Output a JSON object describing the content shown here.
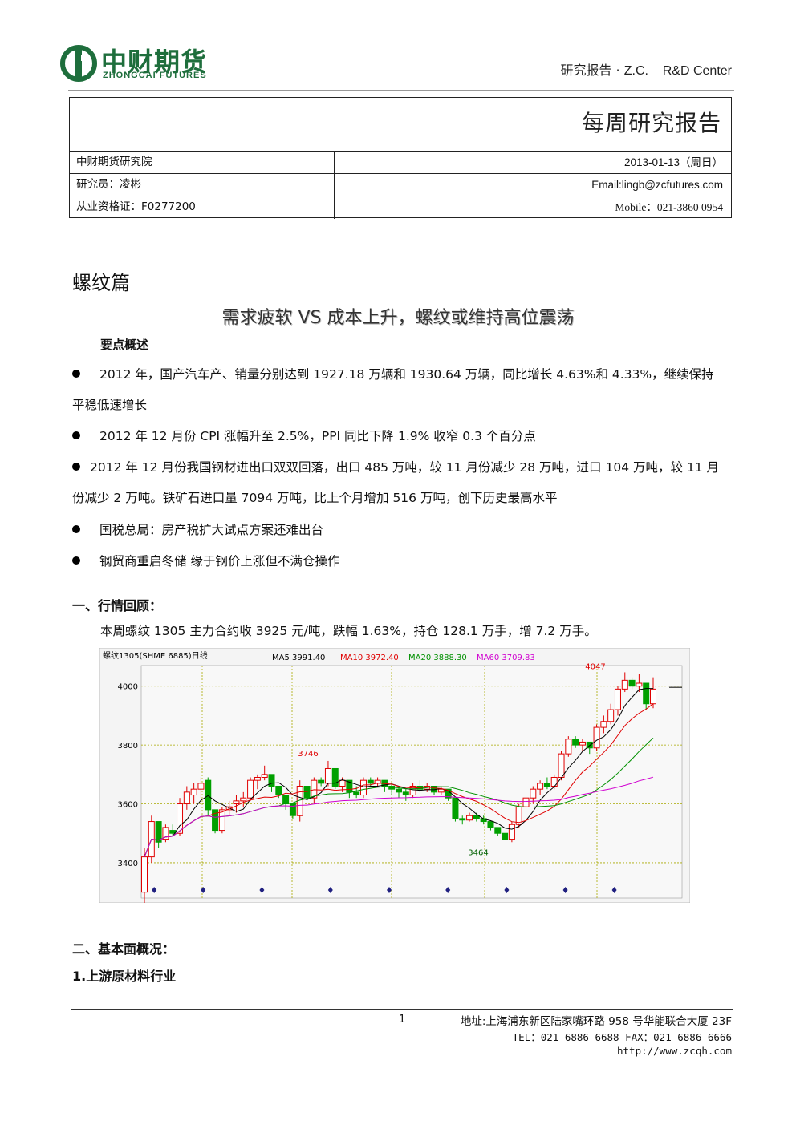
{
  "header": {
    "logo_cn": "中财期货",
    "logo_en": "ZHONGCAI FUTURES",
    "right_text_cn": "研究报告 ·",
    "right_text_en": "Z.C.    R&D Center"
  },
  "info_box": {
    "report_title": "每周研究报告",
    "rows": [
      {
        "left": "中财期货研究院",
        "right": "2013-01-13（周日）"
      },
      {
        "left": "研究员：凌彬",
        "right": "Email:lingb@zcfutures.com"
      },
      {
        "left": "从业资格证：F0277200",
        "right": "Mobile：021-3860  0954"
      }
    ]
  },
  "section_heading": "螺纹篇",
  "article_title": "需求疲软 VS 成本上升，螺纹或维持高位震荡",
  "summary_label": "要点概述",
  "bullets": [
    "2012 年，国产汽车产、销量分别达到 1927.18 万辆和 1930.64 万辆，同比增长 4.63%和 4.33%，继续保持平稳低速增长",
    "2012 年 12 月份 CPI 涨幅升至 2.5%，PPI 同比下降 1.9%  收窄 0.3 个百分点",
    "2012 年 12 月份我国钢材进出口双双回落，出口 485 万吨，较 11 月份减少 28 万吨，进口 104 万吨，较 11 月份减少 2 万吨。铁矿石进口量 7094 万吨，比上个月增加 516 万吨，创下历史最高水平",
    "国税总局：房产税扩大试点方案还难出台",
    "钢贸商重启冬储  缘于钢价上涨但不满仓操作"
  ],
  "review": {
    "heading": "一、行情回顾：",
    "text": "本周螺纹 1305 主力合约收 3925 元/吨，跌幅 1.63%，持仓 128.1 万手，增 7.2 万手。"
  },
  "chart_data": {
    "type": "candlestick",
    "title": "螺纹1305(SHME 6885)日线",
    "legend": [
      {
        "label": "MA5 3991.40",
        "color": "#000000"
      },
      {
        "label": "MA10 3972.40",
        "color": "#e00000"
      },
      {
        "label": "MA20 3888.30",
        "color": "#009000"
      },
      {
        "label": "MA60 3709.83",
        "color": "#d000d0"
      }
    ],
    "ylim": [
      3280,
      4070
    ],
    "yticks": [
      3400,
      3600,
      3800,
      4000
    ],
    "annotations": [
      {
        "text": "3746",
        "color": "#e00000"
      },
      {
        "text": "3464",
        "color": "#006000"
      },
      {
        "text": "4047",
        "color": "#e00000"
      }
    ],
    "candles": [
      [
        3300,
        3450,
        3260,
        3420
      ],
      [
        3420,
        3560,
        3400,
        3540
      ],
      [
        3540,
        3510,
        3450,
        3470
      ],
      [
        3480,
        3530,
        3470,
        3520
      ],
      [
        3510,
        3530,
        3490,
        3500
      ],
      [
        3500,
        3620,
        3490,
        3600
      ],
      [
        3600,
        3660,
        3580,
        3640
      ],
      [
        3630,
        3670,
        3600,
        3650
      ],
      [
        3650,
        3690,
        3620,
        3670
      ],
      [
        3680,
        3690,
        3560,
        3580
      ],
      [
        3580,
        3540,
        3500,
        3510
      ],
      [
        3510,
        3590,
        3500,
        3580
      ],
      [
        3580,
        3610,
        3560,
        3590
      ],
      [
        3600,
        3630,
        3570,
        3610
      ],
      [
        3610,
        3640,
        3590,
        3620
      ],
      [
        3620,
        3690,
        3610,
        3680
      ],
      [
        3680,
        3700,
        3650,
        3690
      ],
      [
        3690,
        3730,
        3680,
        3700
      ],
      [
        3700,
        3680,
        3640,
        3660
      ],
      [
        3660,
        3650,
        3620,
        3630
      ],
      [
        3630,
        3620,
        3580,
        3600
      ],
      [
        3600,
        3580,
        3550,
        3560
      ],
      [
        3560,
        3680,
        3540,
        3660
      ],
      [
        3660,
        3640,
        3610,
        3620
      ],
      [
        3620,
        3690,
        3600,
        3680
      ],
      [
        3680,
        3690,
        3660,
        3670
      ],
      [
        3670,
        3746,
        3660,
        3720
      ],
      [
        3720,
        3690,
        3650,
        3660
      ],
      [
        3660,
        3690,
        3640,
        3680
      ],
      [
        3680,
        3670,
        3620,
        3640
      ],
      [
        3640,
        3660,
        3620,
        3630
      ],
      [
        3630,
        3690,
        3620,
        3680
      ],
      [
        3680,
        3690,
        3660,
        3670
      ],
      [
        3670,
        3690,
        3660,
        3680
      ],
      [
        3680,
        3670,
        3640,
        3660
      ],
      [
        3660,
        3670,
        3630,
        3650
      ],
      [
        3650,
        3660,
        3620,
        3640
      ],
      [
        3640,
        3650,
        3610,
        3630
      ],
      [
        3630,
        3670,
        3620,
        3660
      ],
      [
        3660,
        3680,
        3640,
        3650
      ],
      [
        3650,
        3670,
        3640,
        3660
      ],
      [
        3660,
        3650,
        3630,
        3640
      ],
      [
        3640,
        3660,
        3630,
        3650
      ],
      [
        3650,
        3640,
        3610,
        3620
      ],
      [
        3620,
        3560,
        3540,
        3550
      ],
      [
        3550,
        3560,
        3530,
        3545
      ],
      [
        3545,
        3570,
        3540,
        3560
      ],
      [
        3560,
        3570,
        3540,
        3550
      ],
      [
        3550,
        3560,
        3530,
        3540
      ],
      [
        3540,
        3530,
        3510,
        3520
      ],
      [
        3520,
        3510,
        3490,
        3500
      ],
      [
        3500,
        3464,
        3464,
        3480
      ],
      [
        3480,
        3540,
        3470,
        3530
      ],
      [
        3530,
        3600,
        3520,
        3590
      ],
      [
        3590,
        3640,
        3580,
        3620
      ],
      [
        3620,
        3660,
        3600,
        3650
      ],
      [
        3650,
        3680,
        3630,
        3670
      ],
      [
        3670,
        3690,
        3650,
        3660
      ],
      [
        3660,
        3700,
        3650,
        3690
      ],
      [
        3690,
        3780,
        3680,
        3770
      ],
      [
        3770,
        3830,
        3760,
        3820
      ],
      [
        3820,
        3830,
        3790,
        3800
      ],
      [
        3800,
        3820,
        3780,
        3810
      ],
      [
        3810,
        3800,
        3770,
        3790
      ],
      [
        3790,
        3870,
        3780,
        3860
      ],
      [
        3860,
        3900,
        3840,
        3880
      ],
      [
        3880,
        3940,
        3870,
        3920
      ],
      [
        3920,
        4000,
        3900,
        3990
      ],
      [
        3990,
        4047,
        3980,
        4020
      ],
      [
        4020,
        4030,
        3990,
        4000
      ],
      [
        4000,
        4040,
        3980,
        4010
      ],
      [
        4010,
        3990,
        3920,
        3940
      ],
      [
        3940,
        4030,
        3925,
        3990
      ]
    ]
  },
  "fundamentals": {
    "heading": "二、基本面概况：",
    "subheading": "1.上游原材料行业"
  },
  "footer": {
    "page_number": "1",
    "address": "地址:上海浦东新区陆家嘴环路 958 号华能联合大厦 23F",
    "tel": "TEL：021-6886 6688 FAX：021-6886 6666",
    "web": "http://www.zcqh.com"
  }
}
